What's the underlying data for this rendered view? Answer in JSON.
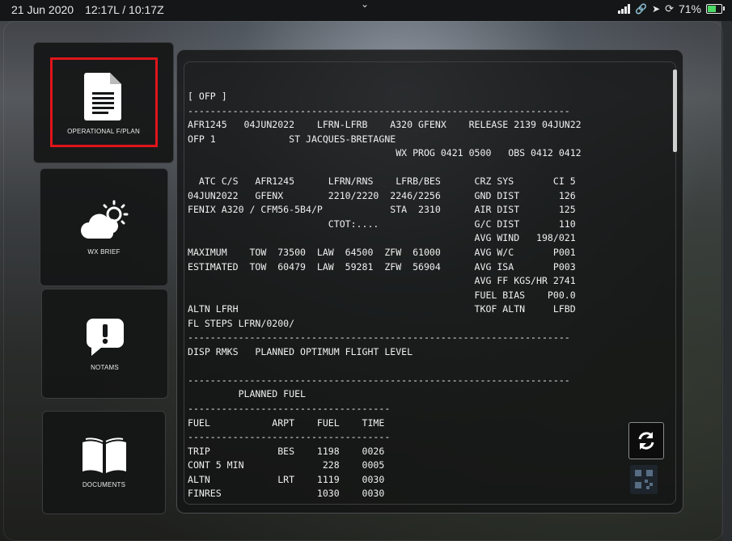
{
  "status_bar": {
    "date": "21 Jun 2020",
    "time": "12:17L / 10:17Z",
    "battery": "71%",
    "battery_level": 0.71
  },
  "sidebar": {
    "items": [
      {
        "label": "OPERATIONAL F/PLAN",
        "icon": "document-icon",
        "selected": true
      },
      {
        "label": "WX BRIEF",
        "icon": "weather-icon",
        "selected": false
      },
      {
        "label": "NOTAMS",
        "icon": "alert-bubble-icon",
        "selected": false
      },
      {
        "label": "DOCUMENTS",
        "icon": "book-icon",
        "selected": false
      }
    ]
  },
  "ofp": {
    "lines": [
      "[ OFP ]",
      "--------------------------------------------------------------------",
      "AFR1245   04JUN2022    LFRN-LFRB    A320 GFENX    RELEASE 2139 04JUN22",
      "OFP 1             ST JACQUES-BRETAGNE",
      "                                     WX PROG 0421 0500   OBS 0412 0412",
      "",
      "  ATC C/S   AFR1245      LFRN/RNS    LFRB/BES      CRZ SYS       CI 5",
      "04JUN2022   GFENX        2210/2220  2246/2256      GND DIST       126",
      "FENIX A320 / CFM56-5B4/P            STA  2310      AIR DIST       125",
      "                         CTOT:....                 G/C DIST       110",
      "                                                   AVG WIND   198/021",
      "MAXIMUM    TOW  73500  LAW  64500  ZFW  61000      AVG W/C       P001",
      "ESTIMATED  TOW  60479  LAW  59281  ZFW  56904      AVG ISA       P003",
      "                                                   AVG FF KGS/HR 2741",
      "                                                   FUEL BIAS    P00.0",
      "ALTN LFRH                                          TKOF ALTN     LFBD",
      "FL STEPS LFRN/0200/",
      "--------------------------------------------------------------------",
      "DISP RMKS   PLANNED OPTIMUM FLIGHT LEVEL",
      "",
      "--------------------------------------------------------------------",
      "         PLANNED FUEL",
      "------------------------------------",
      "FUEL           ARPT    FUEL    TIME",
      "------------------------------------",
      "TRIP            BES    1198    0026",
      "CONT 5 MIN              228    0005",
      "ALTN            LRT    1119    0030",
      "FINRES                 1030    0030"
    ]
  }
}
